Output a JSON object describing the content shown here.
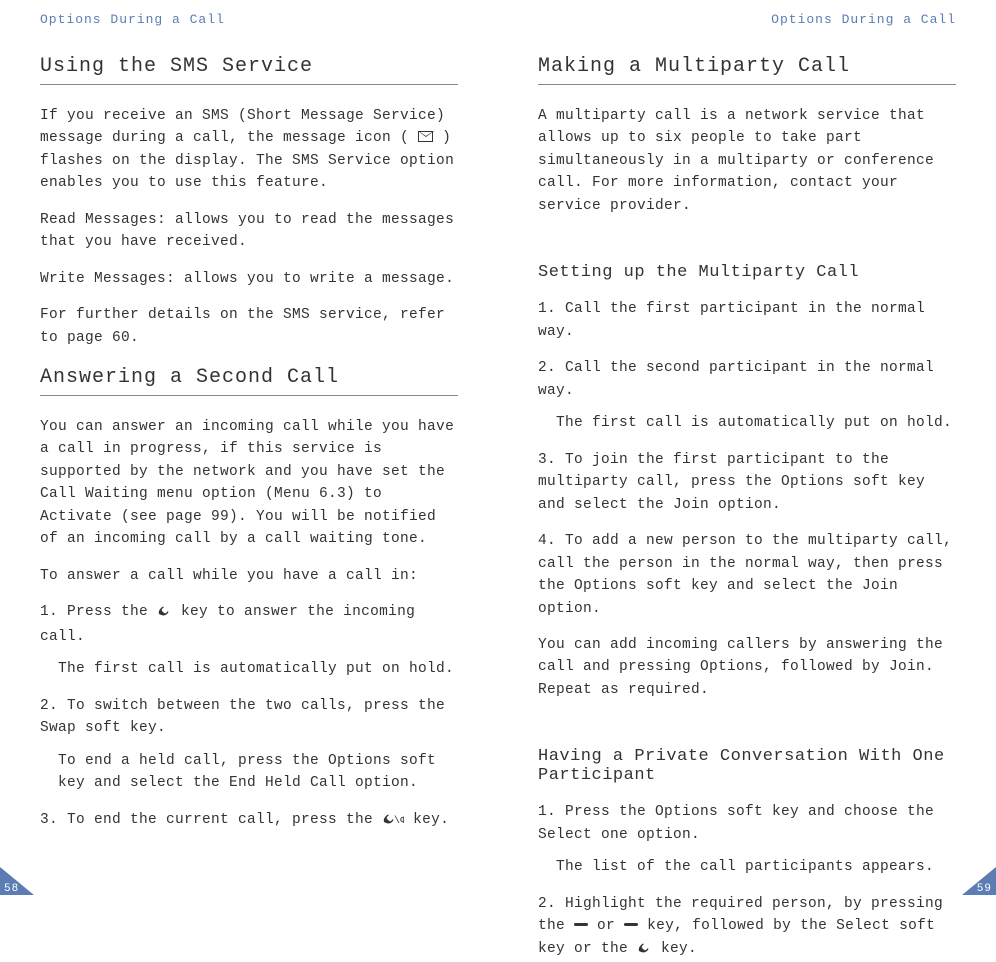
{
  "left": {
    "header": "Options During a Call",
    "sections": {
      "sms": {
        "title": "Using the SMS Service",
        "intro_a": "If you receive an SMS (Short Message Service) message during a call, the message icon (",
        "intro_b": ") flashes on the display. The SMS Service option enables you to use this feature.",
        "read": "Read Messages: allows you to read the messages that you have received.",
        "write": "Write Messages: allows you to write a message.",
        "refer": "For further details on the SMS service, refer to page 60."
      },
      "second": {
        "title": "Answering a Second Call",
        "intro": "You can answer an incoming call while you have a call in progress, if this service is supported by the network and you have set the Call Waiting menu option (Menu 6.3) to Activate (see page 99). You will be notified of an incoming call by a call waiting tone.",
        "lead": "To answer a call while you have a call in:",
        "step1a": "1. Press the ",
        "step1b": " key to answer the incoming call.",
        "step1sub": "The first call is automatically put on hold.",
        "step2": "2. To switch between the two calls, press the Swap soft key.",
        "step2sub": "To end a held call, press the Options soft key and select the End Held Call option.",
        "step3a": "3. To end the current call, press the ",
        "step3b": " key."
      }
    },
    "page_number": "58"
  },
  "right": {
    "header": "Options During a Call",
    "sections": {
      "multi": {
        "title": "Making a Multiparty Call",
        "intro": "A multiparty call is a network service that allows up to six people to take part simultaneously in a multiparty or conference call. For more information, contact your service provider."
      },
      "setup": {
        "title": "Setting up the Multiparty Call",
        "s1": "1. Call the first participant in the normal way.",
        "s2": "2. Call the second participant in the normal way.",
        "s2sub": "The first call is automatically put on hold.",
        "s3": "3. To join the first participant to the multiparty call, press the Options soft key and select the Join option.",
        "s4": "4. To add a new person to the multiparty call, call the person in the normal way, then press the Options soft key and select the Join option.",
        "note": "You can add incoming callers by answering the call and pressing Options, followed by Join. Repeat as required."
      },
      "private": {
        "title": "Having a Private Conversation With One Participant",
        "s1": "1. Press the Options soft key and choose the Select one option.",
        "s1sub": "The list of the call participants appears.",
        "s2a": "2. Highlight the required person, by pressing the ",
        "s2b": " or ",
        "s2c": " key, followed by the Select soft key or the ",
        "s2d": " key."
      }
    },
    "page_number": "59"
  }
}
